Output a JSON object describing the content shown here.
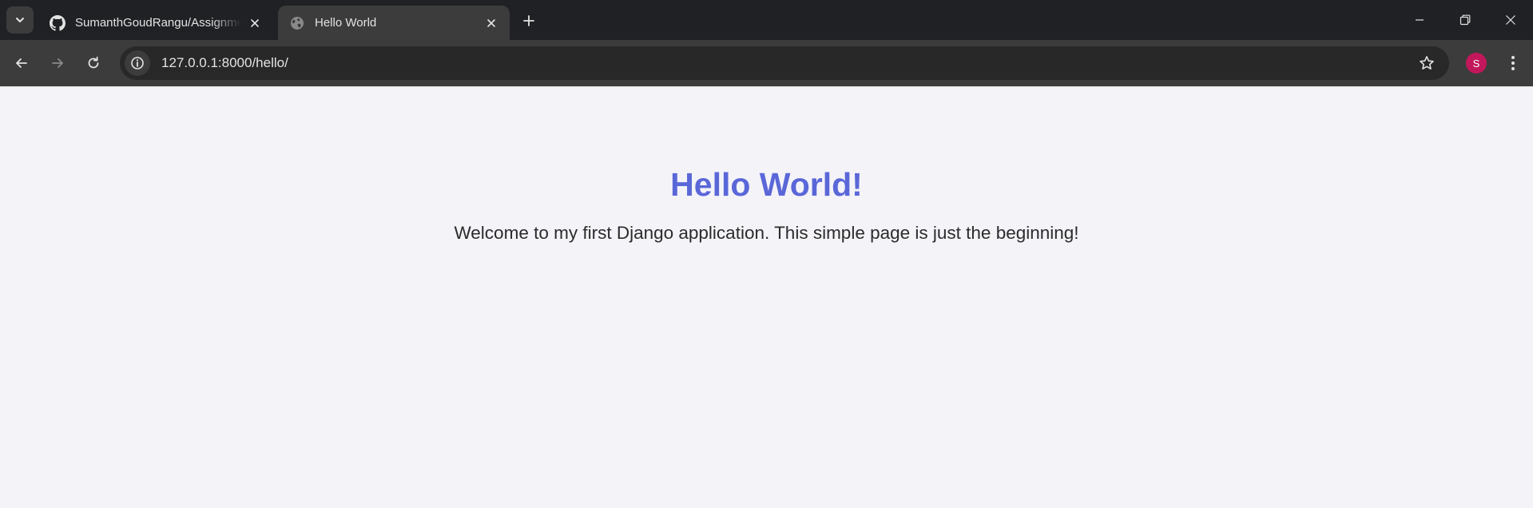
{
  "browser": {
    "tabs": [
      {
        "title": "SumanthGoudRangu/Assignme",
        "favicon": "github-icon",
        "active": false
      },
      {
        "title": "Hello World",
        "favicon": "globe-icon",
        "active": true
      }
    ],
    "address_bar": {
      "url": "127.0.0.1:8000/hello/"
    },
    "profile": {
      "initial": "S",
      "color": "#c2185b"
    }
  },
  "page": {
    "heading": "Hello World!",
    "paragraph": "Welcome to my first Django application. This simple page is just the beginning!",
    "heading_color": "#5a67d8",
    "background_color": "#f4f3f8"
  }
}
